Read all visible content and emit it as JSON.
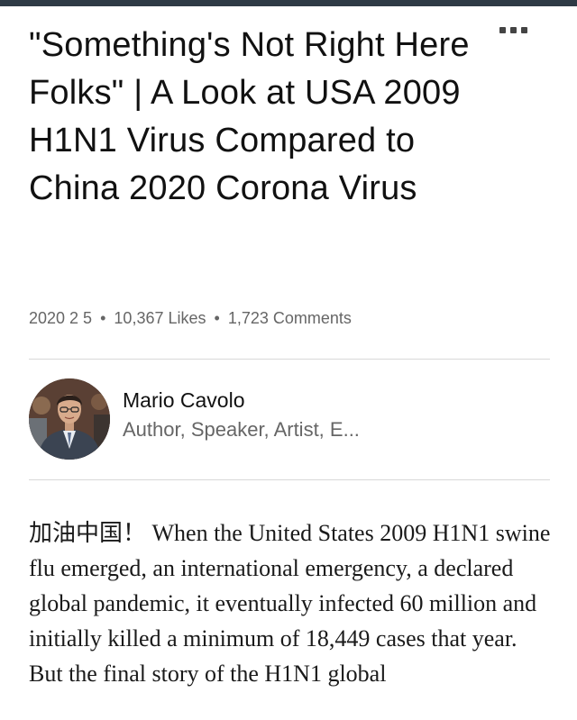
{
  "article": {
    "title": "\"Something's Not Right Here Folks\" | A Look at USA 2009 H1N1 Virus Compared to China 2020 Corona Virus",
    "meta": {
      "date": "2020 2 5",
      "likes": "10,367 Likes",
      "comments": "1,723 Comments",
      "separator": "•"
    },
    "author": {
      "name": "Mario Cavolo",
      "headline": "Author, Speaker, Artist, E..."
    },
    "body": "加油中国！ When the United States 2009 H1N1 swine flu emerged, an international emergency, a declared global pandemic, it eventually infected 60 million and initially killed a minimum of 18,449 cases that year. But the final story of the H1N1 global"
  },
  "toolbar": {
    "more_icon": "more-horizontal-icon"
  },
  "colors": {
    "top_bar": "#2e3a45",
    "meta_text": "#666666",
    "divider": "#d8d8d8"
  }
}
